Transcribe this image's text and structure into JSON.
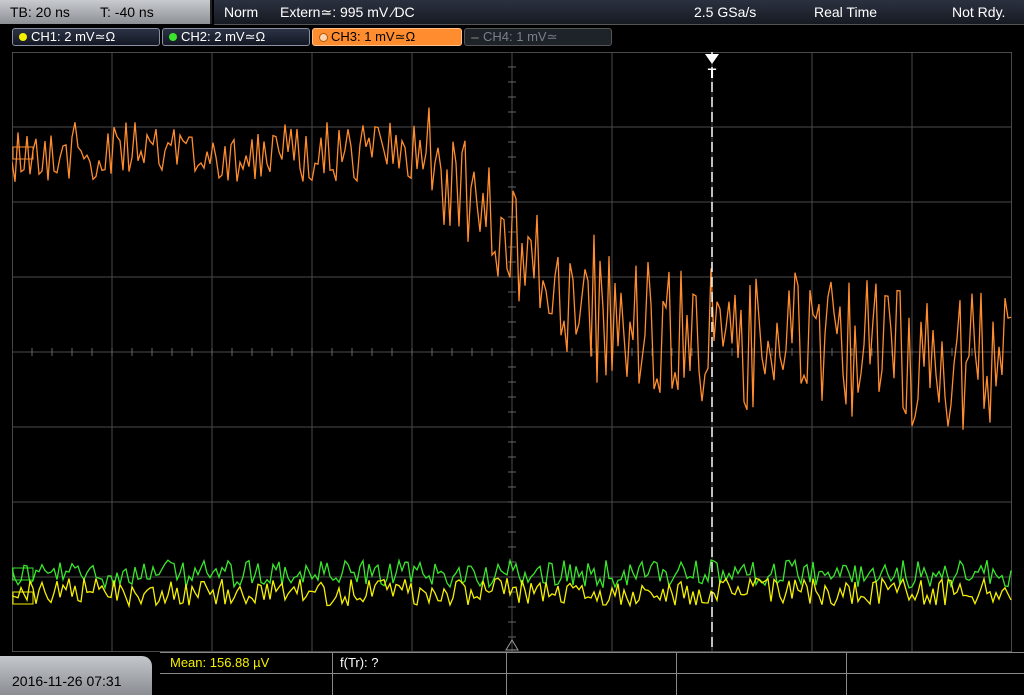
{
  "topbar": {
    "timebase": "TB: 20 ns",
    "trigger_pos": "T: -40 ns",
    "mode": "Norm",
    "trigger_source": "Extern≃: 995 mV ∕DC",
    "sample_rate": "2.5 GSa/s",
    "acq_mode": "Real Time",
    "status": "Not Rdy."
  },
  "channels": [
    {
      "label": "CH1: 2 mV≃Ω",
      "color": "#f5f000"
    },
    {
      "label": "CH2: 2 mV≃Ω",
      "color": "#39e62c"
    },
    {
      "label": "CH3: 1 mV≃Ω",
      "color": "#ff8c2e"
    },
    {
      "label": "CH4: 1 mV≃",
      "color": "#6a6f78"
    }
  ],
  "trigger_marker": "T",
  "measurements": {
    "mean": "Mean: 156.88 µV",
    "ftr": "f(Tr): ?"
  },
  "datetime": "2016-11-26 07:31",
  "colors": {
    "grid": "#4a4a4a",
    "background": "#000000",
    "trigger_line": "#ffffff"
  }
}
